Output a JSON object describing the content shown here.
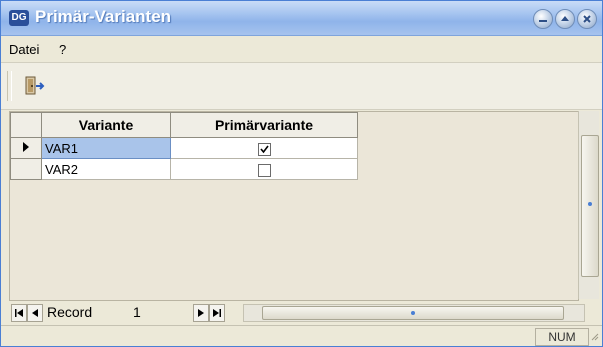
{
  "window": {
    "title": "Primär-Varianten",
    "app_icon_text": "DG",
    "buttons": [
      "minimize-icon",
      "maximize-icon",
      "close-icon"
    ]
  },
  "menu": {
    "items": [
      {
        "label": "Datei"
      },
      {
        "label": "?"
      }
    ]
  },
  "toolbar": {
    "exit_icon": "exit-door-icon"
  },
  "grid": {
    "columns": [
      "Variante",
      "Primärvariante"
    ],
    "rows": [
      {
        "variante": "VAR1",
        "primary": true,
        "current": true
      },
      {
        "variante": "VAR2",
        "primary": false,
        "current": false
      }
    ]
  },
  "navigator": {
    "record_label": "Record",
    "record_number": "1"
  },
  "status": {
    "num_indicator": "NUM"
  },
  "colors": {
    "title_bar": "#a8c6f0",
    "selection": "#a9c4ea",
    "window_bg": "#ece9d8"
  }
}
